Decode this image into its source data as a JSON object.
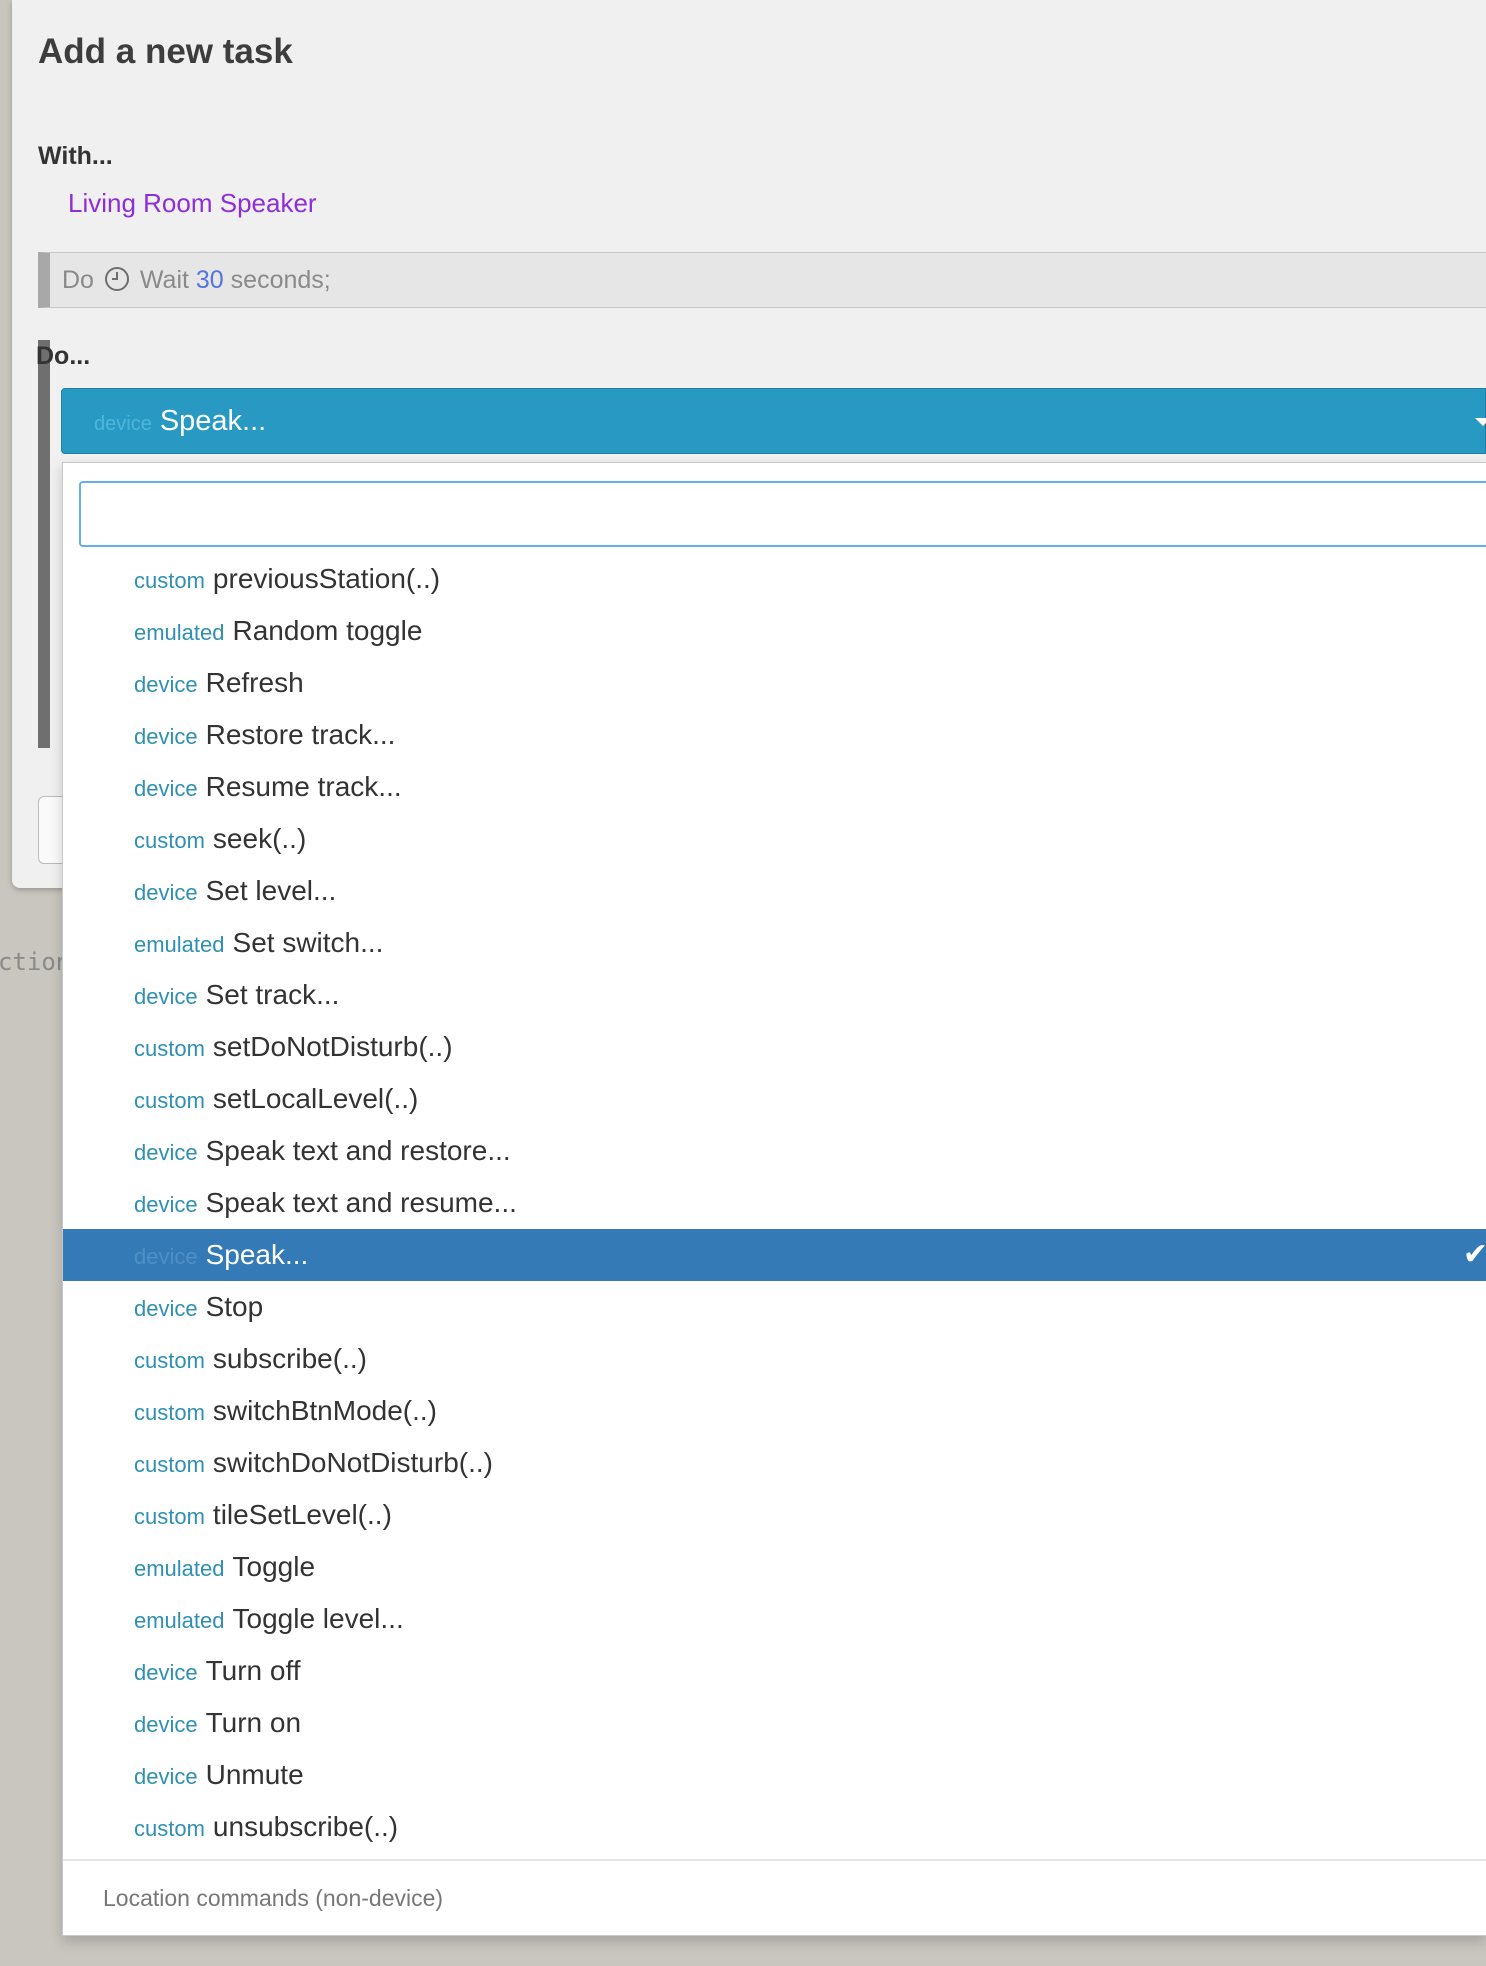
{
  "modal": {
    "title": "Add a new task",
    "with_label": "With...",
    "device_name": "Living Room Speaker",
    "previous_step": {
      "prefix": "Do",
      "text_before": "Wait",
      "number": "30",
      "text_after": "seconds;"
    },
    "do_label": "Do..."
  },
  "select": {
    "tag": "device",
    "value": "Speak..."
  },
  "dropdown": {
    "search_value": "",
    "options": [
      {
        "tag": "custom",
        "label": "previousStation(..)"
      },
      {
        "tag": "emulated",
        "label": "Random toggle"
      },
      {
        "tag": "device",
        "label": "Refresh"
      },
      {
        "tag": "device",
        "label": "Restore track..."
      },
      {
        "tag": "device",
        "label": "Resume track..."
      },
      {
        "tag": "custom",
        "label": "seek(..)"
      },
      {
        "tag": "device",
        "label": "Set level..."
      },
      {
        "tag": "emulated",
        "label": "Set switch..."
      },
      {
        "tag": "device",
        "label": "Set track..."
      },
      {
        "tag": "custom",
        "label": "setDoNotDisturb(..)"
      },
      {
        "tag": "custom",
        "label": "setLocalLevel(..)"
      },
      {
        "tag": "device",
        "label": "Speak text and restore..."
      },
      {
        "tag": "device",
        "label": "Speak text and resume..."
      },
      {
        "tag": "device",
        "label": "Speak...",
        "selected": true
      },
      {
        "tag": "device",
        "label": "Stop"
      },
      {
        "tag": "custom",
        "label": "subscribe(..)"
      },
      {
        "tag": "custom",
        "label": "switchBtnMode(..)"
      },
      {
        "tag": "custom",
        "label": "switchDoNotDisturb(..)"
      },
      {
        "tag": "custom",
        "label": "tileSetLevel(..)"
      },
      {
        "tag": "emulated",
        "label": "Toggle"
      },
      {
        "tag": "emulated",
        "label": "Toggle level..."
      },
      {
        "tag": "device",
        "label": "Turn off"
      },
      {
        "tag": "device",
        "label": "Turn on"
      },
      {
        "tag": "device",
        "label": "Unmute"
      },
      {
        "tag": "custom",
        "label": "unsubscribe(..)"
      }
    ],
    "footer_header": "Location commands (non-device)"
  },
  "background": {
    "fragment": "ction"
  },
  "colors": {
    "accent": "#2799c2",
    "selected": "#337ab7",
    "tag": "#2f8fb5",
    "device_name": "#8d2ed6"
  },
  "icons": {
    "previous_step": "clock-icon",
    "select": "caret-down-icon",
    "selected_option": "check-icon"
  }
}
